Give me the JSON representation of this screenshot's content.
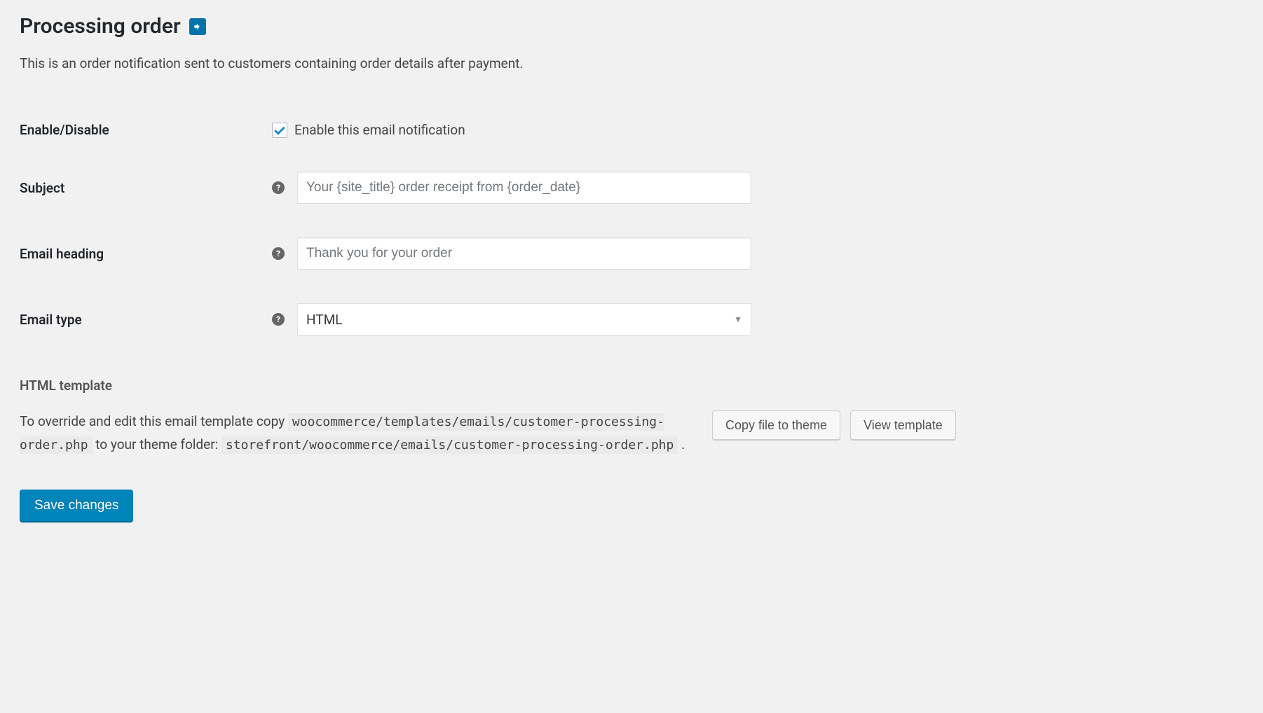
{
  "header": {
    "title": "Processing order"
  },
  "description": "This is an order notification sent to customers containing order details after payment.",
  "fields": {
    "enable": {
      "label": "Enable/Disable",
      "checkbox_label": "Enable this email notification",
      "checked": true
    },
    "subject": {
      "label": "Subject",
      "placeholder": "Your {site_title} order receipt from {order_date}",
      "value": ""
    },
    "heading": {
      "label": "Email heading",
      "placeholder": "Thank you for your order",
      "value": ""
    },
    "type": {
      "label": "Email type",
      "value": "HTML"
    }
  },
  "template": {
    "section_label": "HTML template",
    "text_prefix": "To override and edit this email template copy ",
    "code_source": "woocommerce/templates/emails/customer-processing-order.php",
    "text_middle": " to your theme folder: ",
    "code_dest": "storefront/woocommerce/emails/customer-processing-order.php",
    "text_suffix": " .",
    "copy_button": "Copy file to theme",
    "view_button": "View template"
  },
  "actions": {
    "save": "Save changes"
  }
}
